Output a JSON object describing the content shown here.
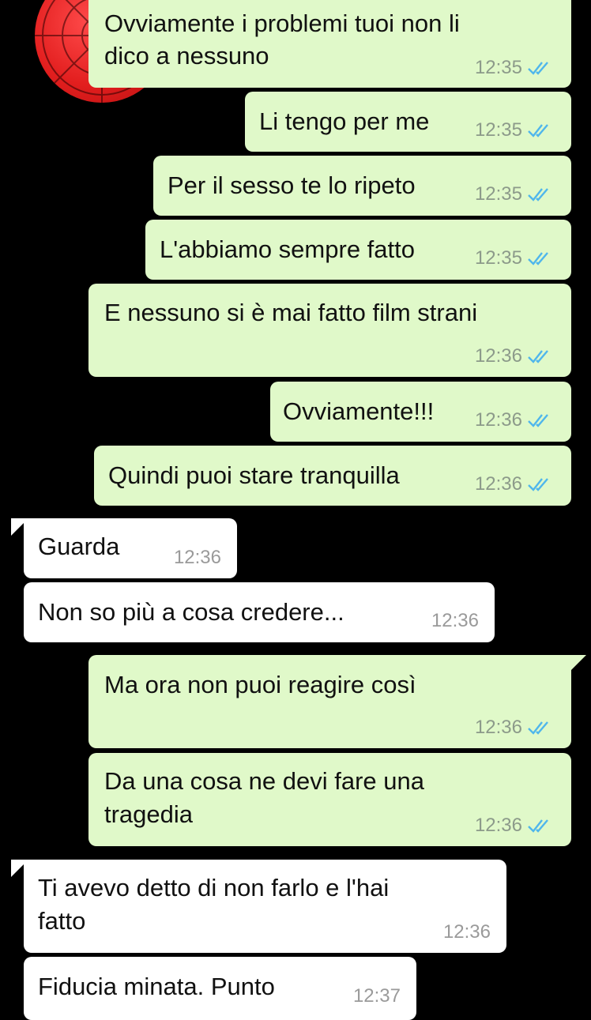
{
  "theme": {
    "outgoing_bg": "#e0f9c9",
    "incoming_bg": "#ffffff",
    "tick_color": "#4fb6ec",
    "background": "#000000"
  },
  "messages": [
    {
      "direction": "outgoing",
      "lines": [
        "Ovviamente i problemi tuoi non li",
        "dico a nessuno"
      ],
      "time": "12:35",
      "status": "read"
    },
    {
      "direction": "outgoing",
      "lines": [
        "Li tengo per me"
      ],
      "time": "12:35",
      "status": "read"
    },
    {
      "direction": "outgoing",
      "lines": [
        "Per il sesso te lo ripeto"
      ],
      "time": "12:35",
      "status": "read"
    },
    {
      "direction": "outgoing",
      "lines": [
        "L'abbiamo sempre fatto"
      ],
      "time": "12:35",
      "status": "read"
    },
    {
      "direction": "outgoing",
      "lines": [
        "E nessuno si è mai fatto film strani"
      ],
      "time": "12:36",
      "status": "read"
    },
    {
      "direction": "outgoing",
      "lines": [
        "Ovviamente!!!"
      ],
      "time": "12:36",
      "status": "read"
    },
    {
      "direction": "outgoing",
      "lines": [
        "Quindi puoi stare tranquilla"
      ],
      "time": "12:36",
      "status": "read"
    },
    {
      "direction": "incoming",
      "lines": [
        "Guarda"
      ],
      "time": "12:36"
    },
    {
      "direction": "incoming",
      "lines": [
        "Non so più a cosa credere..."
      ],
      "time": "12:36"
    },
    {
      "direction": "outgoing",
      "lines": [
        "Ma ora non puoi reagire così"
      ],
      "time": "12:36",
      "status": "read"
    },
    {
      "direction": "outgoing",
      "lines": [
        "Da una cosa ne devi fare una",
        "tragedia"
      ],
      "time": "12:36",
      "status": "read"
    },
    {
      "direction": "incoming",
      "lines": [
        "Ti avevo detto di non farlo e l'hai",
        "fatto"
      ],
      "time": "12:36"
    },
    {
      "direction": "incoming",
      "lines": [
        "Fiducia minata. Punto"
      ],
      "time": "12:37"
    }
  ]
}
